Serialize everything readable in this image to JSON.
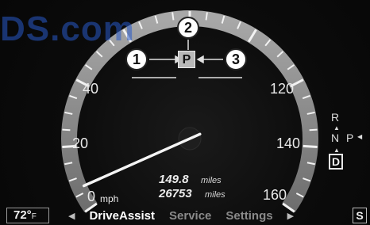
{
  "watermark": "DS.com",
  "speedometer": {
    "tick_labels": [
      "40",
      "120",
      "20",
      "140",
      "160"
    ],
    "zero_label": "0",
    "unit": "mph",
    "needle_speed_mph": 7,
    "max_speed_mph": 160
  },
  "odometer": {
    "trip_value": "149.8",
    "trip_unit": "miles",
    "total_value": "26753",
    "total_unit": "miles"
  },
  "callouts": [
    "1",
    "2",
    "3"
  ],
  "park_indicator": "P",
  "gear_selector": {
    "r": "R",
    "n": "N",
    "p": "P",
    "d": "D",
    "selected": "D"
  },
  "bottom_bar": {
    "temperature": "72°",
    "temperature_unit": "F",
    "menu_items": [
      "DriveAssist",
      "Service",
      "Settings"
    ],
    "active_menu": "DriveAssist",
    "mode_label": "S"
  },
  "colors": {
    "gauge_ring": "#8e8e8e",
    "needle": "#f4f4f4",
    "watermark": "#2a5bd0"
  }
}
